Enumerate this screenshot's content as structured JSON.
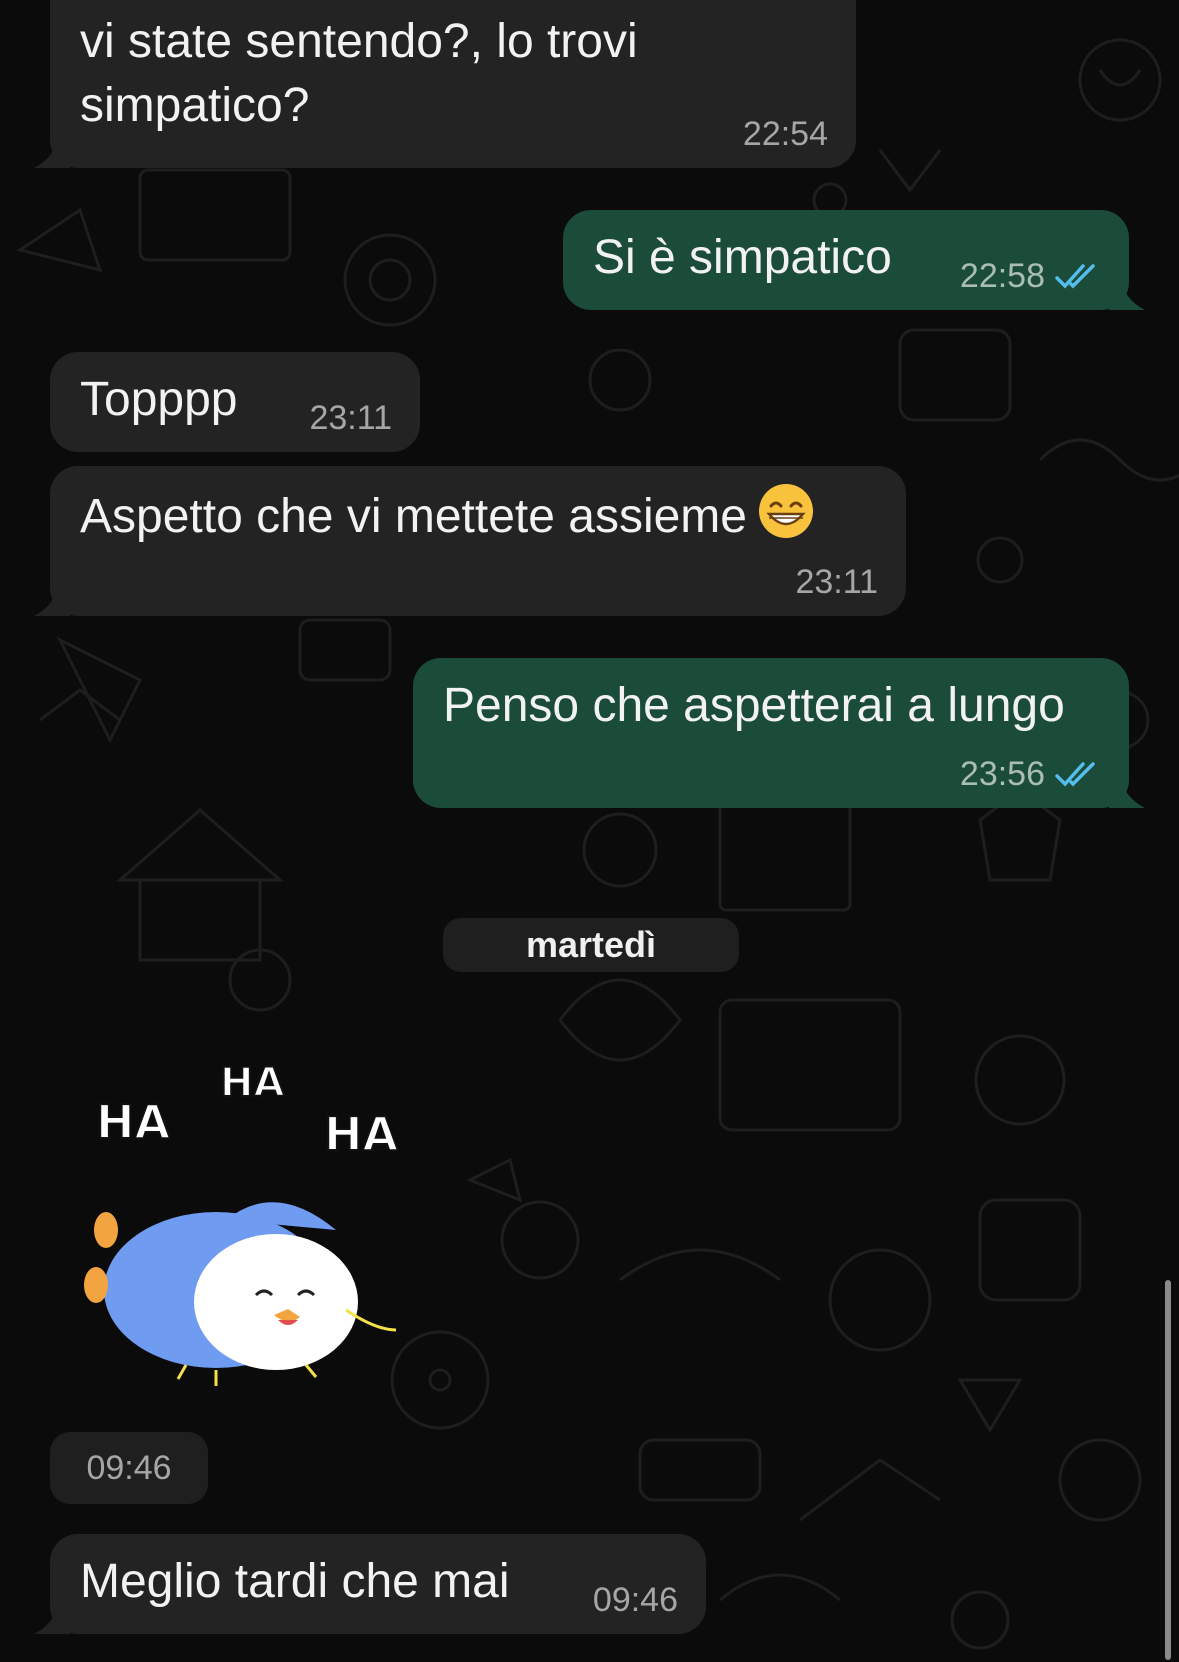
{
  "messages": [
    {
      "direction": "in",
      "text_line1": "vi state sentendo?, lo trovi",
      "text_line2": "simpatico?",
      "time": "22:54"
    },
    {
      "direction": "out",
      "text": "Si è simpatico",
      "time": "22:58",
      "status": "read"
    },
    {
      "direction": "in",
      "text": "Topppp",
      "time": "23:11"
    },
    {
      "direction": "in",
      "text": "Aspetto che vi mettete assieme",
      "emoji": "grinning-face-with-smiling-eyes-icon",
      "time": "23:11"
    },
    {
      "direction": "out",
      "text": "Penso che aspetterai a lungo",
      "time": "23:56",
      "status": "read"
    },
    {
      "type": "sticker",
      "sticker_text": [
        "HA",
        "HA",
        "HA"
      ],
      "icon": "laughing-penguin-sticker",
      "time": "09:46"
    },
    {
      "direction": "in",
      "text": "Meglio tardi che mai",
      "time": "09:46"
    }
  ],
  "date_separator": "martedì",
  "colors": {
    "background": "#0b0b0b",
    "incoming_bubble": "#232323",
    "outgoing_bubble": "#1b4b39",
    "read_ticks": "#53bdeb",
    "timestamp": "#a6a6a6"
  }
}
